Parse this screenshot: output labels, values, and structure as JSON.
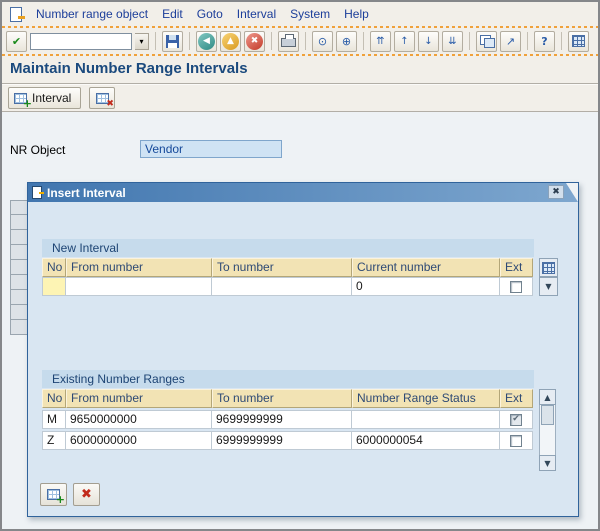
{
  "menu_bar": {
    "items": [
      "Number range object",
      "Edit",
      "Goto",
      "Interval",
      "System",
      "Help"
    ]
  },
  "toolbar": {
    "command_value": ""
  },
  "page": {
    "title": "Maintain Number Range Intervals"
  },
  "app_toolbar": {
    "interval_label": "Interval"
  },
  "form": {
    "nr_object_label": "NR Object",
    "nr_object_value": "Vendor"
  },
  "dialog": {
    "title": "Insert Interval",
    "new_interval": {
      "title": "New Interval",
      "columns": [
        "No",
        "From number",
        "To number",
        "Current number",
        "Ext"
      ],
      "row": {
        "no": "",
        "from": "",
        "to": "",
        "current": "0",
        "ext": false
      }
    },
    "existing": {
      "title": "Existing Number Ranges",
      "columns": [
        "No",
        "From number",
        "To number",
        "Number Range Status",
        "Ext"
      ],
      "rows": [
        {
          "no": "M",
          "from": "9650000000",
          "to": "9699999999",
          "status": "",
          "ext": true
        },
        {
          "no": "Z",
          "from": "6000000000",
          "to": "6999999999",
          "status": "6000000054",
          "ext": false
        }
      ]
    }
  },
  "icons": {
    "enter": "✔",
    "dropdown": "▾",
    "back": "◀",
    "exit": "▲",
    "cancel": "✖",
    "find": "⊙",
    "find_next": "⊕",
    "first_page": "⇈",
    "prev_page": "↑",
    "next_page": "↓",
    "last_page": "⇊",
    "shortcut": "↗",
    "help": "?",
    "close": "✖",
    "scroll_up": "▲",
    "scroll_down": "▼",
    "plus": "+"
  },
  "colors": {
    "accent_orange": "#f0a13b",
    "title_blue": "#1b4a7e",
    "dialog_titlebar": "#4176af",
    "table_header_bg": "#f2e3b4",
    "required_cell_bg": "#fdf4b4",
    "dialog_bg": "#d9e6f2"
  }
}
